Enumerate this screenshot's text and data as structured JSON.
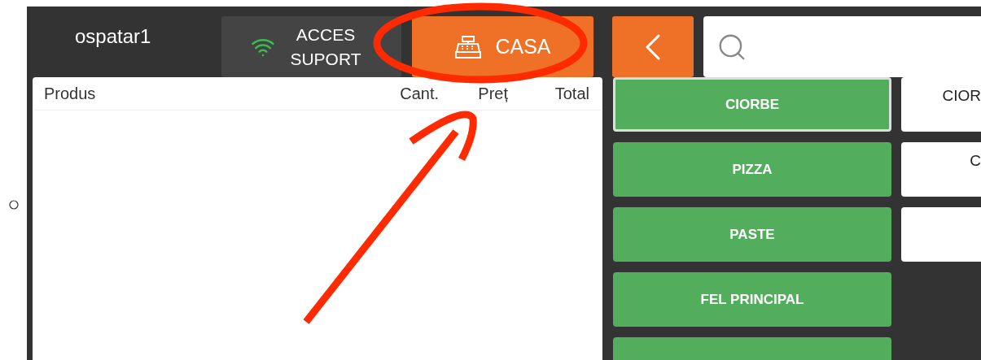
{
  "user": "ospatar1",
  "support_button": {
    "label": "ACCES SUPORT"
  },
  "register_button": {
    "label": "CASA"
  },
  "order_table": {
    "columns": [
      "Produs",
      "Cant.",
      "Preț",
      "Total"
    ]
  },
  "categories": [
    {
      "label": "CIORBE",
      "selected": true
    },
    {
      "label": "PIZZA",
      "selected": false
    },
    {
      "label": "PASTE",
      "selected": false
    },
    {
      "label": "FEL PRINCIPAL",
      "selected": false
    },
    {
      "selected": false
    }
  ],
  "products": [
    {
      "kind": "labeled",
      "label": "CIOR"
    },
    {
      "kind": "labeled",
      "label": "C"
    },
    {
      "kind": "empty"
    }
  ]
}
